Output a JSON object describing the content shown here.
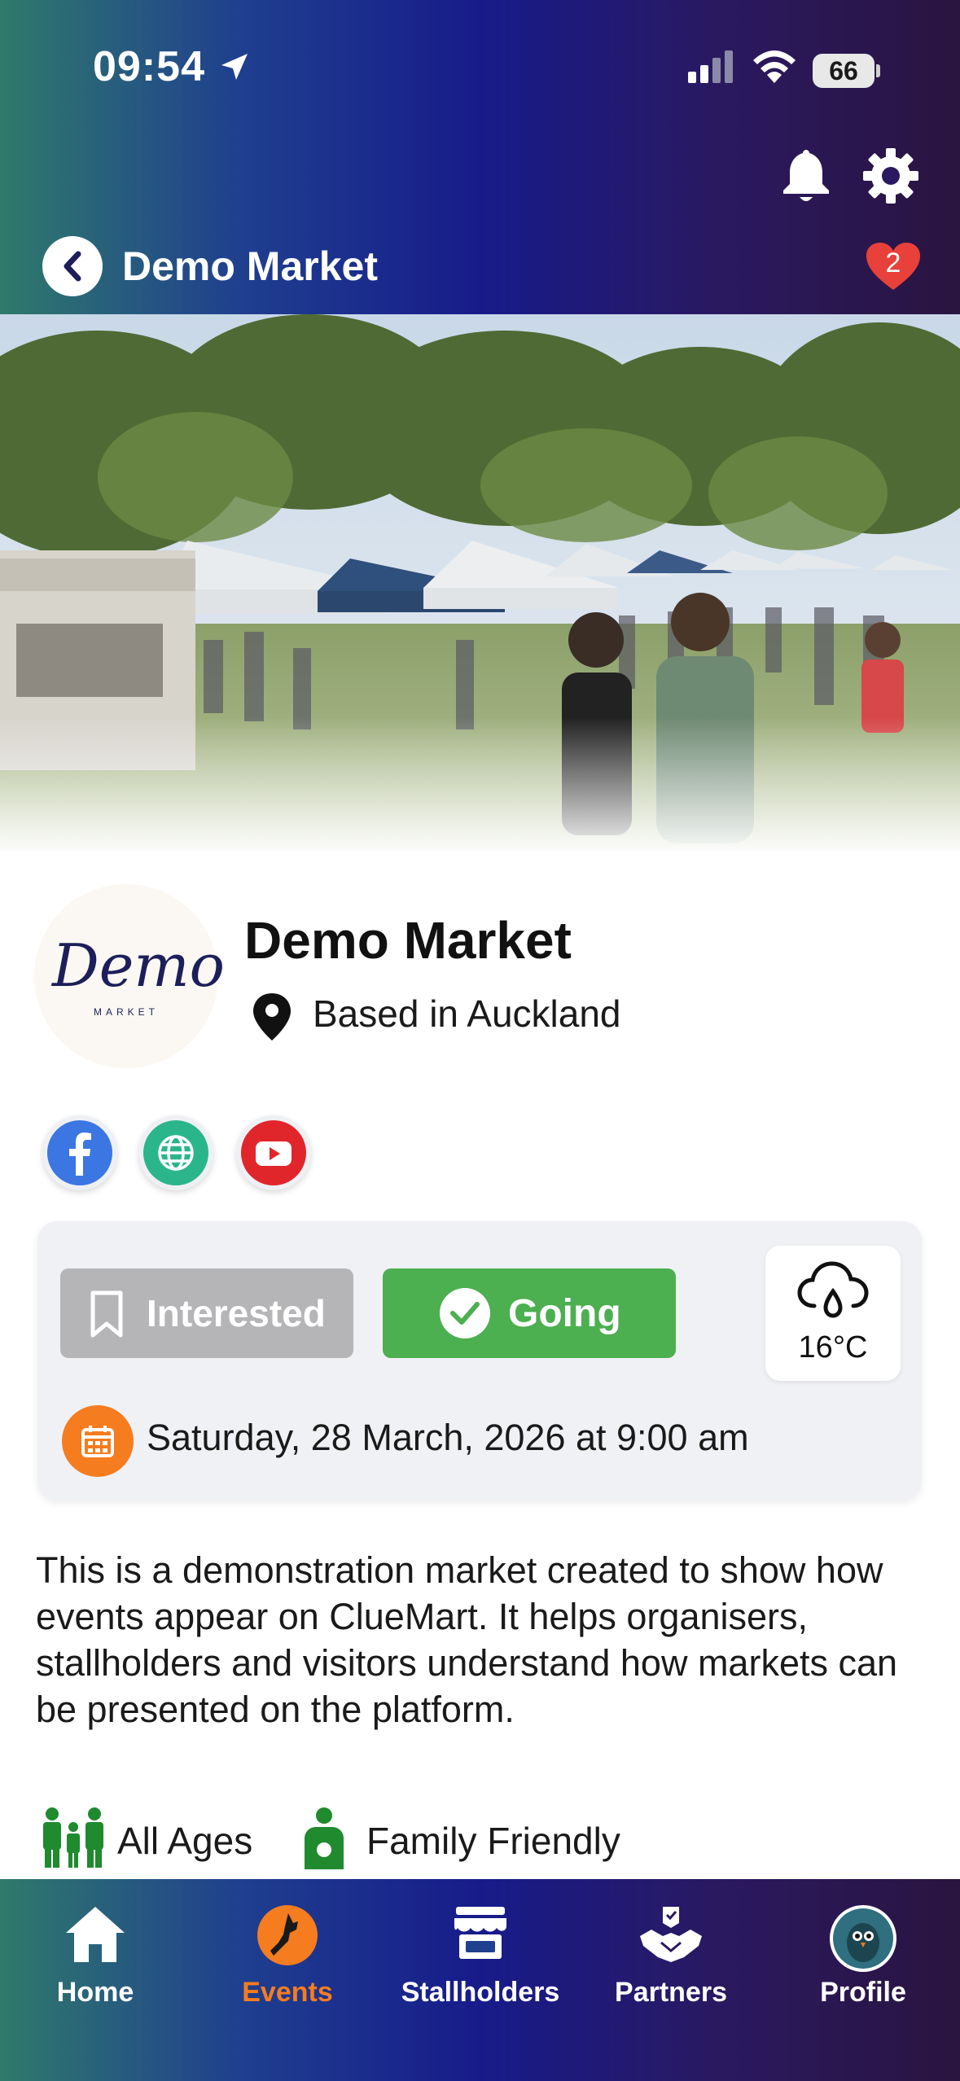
{
  "status_bar": {
    "time": "09:54",
    "battery": "66"
  },
  "header": {
    "title": "Demo Market",
    "favorites_count": "2"
  },
  "market": {
    "logo_text": "Demo",
    "logo_subtext": "MARKET",
    "name": "Demo Market",
    "location": "Based in Auckland"
  },
  "social": [
    "facebook-icon",
    "website-icon",
    "youtube-icon"
  ],
  "actions": {
    "interested": "Interested",
    "going": "Going"
  },
  "weather": {
    "temperature": "16°C"
  },
  "event": {
    "date": "Saturday, 28 March, 2026 at 9:00 am"
  },
  "description": "This is a demonstration market created to show how events appear on ClueMart. It helps organisers, stallholders and visitors understand how markets can be presented on the platform.",
  "features": [
    {
      "label": "All Ages",
      "icon": "family-icon"
    },
    {
      "label": "Family Friendly",
      "icon": "person-icon"
    }
  ],
  "nav": [
    {
      "label": "Home",
      "icon": "home-icon"
    },
    {
      "label": "Events",
      "icon": "nz-map-icon",
      "active": true
    },
    {
      "label": "Stallholders",
      "icon": "stall-icon"
    },
    {
      "label": "Partners",
      "icon": "handshake-icon"
    },
    {
      "label": "Profile",
      "icon": "avatar-icon"
    }
  ],
  "colors": {
    "accent": "#f57c1f",
    "going": "#4caf50",
    "interested": "#b5b5b8"
  }
}
